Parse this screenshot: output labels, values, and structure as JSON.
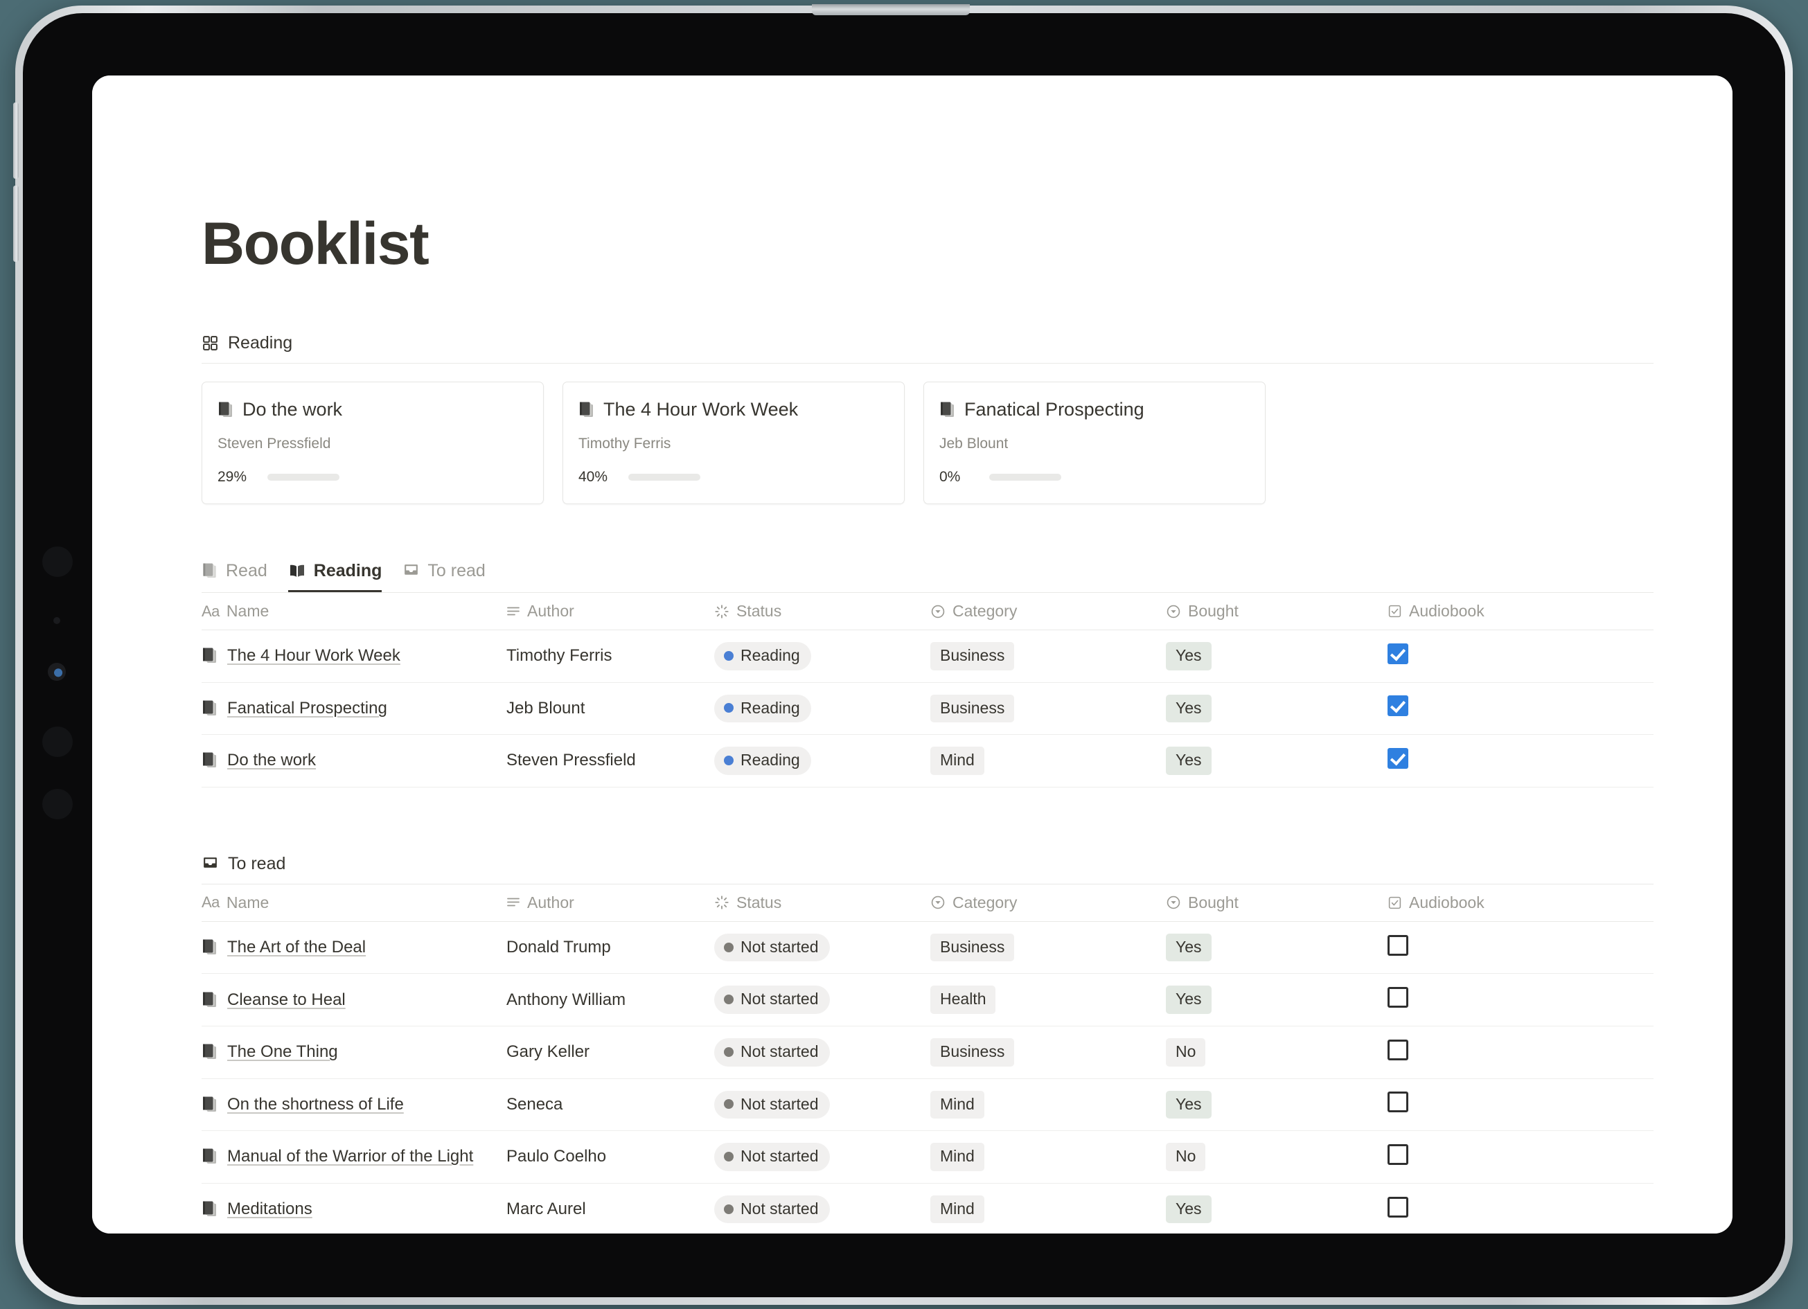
{
  "page": {
    "title": "Booklist"
  },
  "view": {
    "label": "Reading",
    "icon": "gallery-grid-icon"
  },
  "cards": [
    {
      "title": "Do the work",
      "author": "Steven Pressfield",
      "progress_label": "29%",
      "progress": 29,
      "icon": "closed-book-icon"
    },
    {
      "title": "The 4 Hour Work Week",
      "author": "Timothy Ferris",
      "progress_label": "40%",
      "progress": 40,
      "icon": "closed-book-icon"
    },
    {
      "title": "Fanatical Prospecting",
      "author": "Jeb Blount",
      "progress_label": "0%",
      "progress": 0,
      "icon": "closed-book-icon"
    }
  ],
  "tabs": [
    {
      "label": "Read",
      "icon": "closed-book-icon",
      "active": false
    },
    {
      "label": "Reading",
      "icon": "open-book-icon",
      "active": true
    },
    {
      "label": "To read",
      "icon": "inbox-tray-icon",
      "active": false
    }
  ],
  "columns": [
    {
      "label": "Name",
      "icon": "text-aa-icon"
    },
    {
      "label": "Author",
      "icon": "text-lines-icon"
    },
    {
      "label": "Status",
      "icon": "status-spinner-icon"
    },
    {
      "label": "Category",
      "icon": "select-circle-icon"
    },
    {
      "label": "Bought",
      "icon": "select-circle-icon"
    },
    {
      "label": "Audiobook",
      "icon": "checkbox-icon"
    }
  ],
  "reading_table": {
    "rows": [
      {
        "name": "The 4 Hour Work Week",
        "author": "Timothy Ferris",
        "status": "Reading",
        "status_color": "#4a7fd4",
        "category": "Business",
        "bought": "Yes",
        "audiobook": true
      },
      {
        "name": "Fanatical Prospecting",
        "author": "Jeb Blount",
        "status": "Reading",
        "status_color": "#4a7fd4",
        "category": "Business",
        "bought": "Yes",
        "audiobook": true
      },
      {
        "name": "Do the work",
        "author": "Steven Pressfield",
        "status": "Reading",
        "status_color": "#4a7fd4",
        "category": "Mind",
        "bought": "Yes",
        "audiobook": true
      }
    ]
  },
  "toread_section": {
    "label": "To read",
    "icon": "inbox-tray-icon",
    "rows": [
      {
        "name": "The Art of the Deal",
        "author": "Donald Trump",
        "status": "Not started",
        "status_color": "#7d7b76",
        "category": "Business",
        "bought": "Yes",
        "audiobook": false
      },
      {
        "name": "Cleanse to Heal",
        "author": "Anthony William",
        "status": "Not started",
        "status_color": "#7d7b76",
        "category": "Health",
        "bought": "Yes",
        "audiobook": false
      },
      {
        "name": "The One Thing",
        "author": "Gary Keller",
        "status": "Not started",
        "status_color": "#7d7b76",
        "category": "Business",
        "bought": "No",
        "audiobook": false
      },
      {
        "name": "On the shortness of Life",
        "author": "Seneca",
        "status": "Not started",
        "status_color": "#7d7b76",
        "category": "Mind",
        "bought": "Yes",
        "audiobook": false
      },
      {
        "name": "Manual of the Warrior of the Light",
        "author": "Paulo Coelho",
        "status": "Not started",
        "status_color": "#7d7b76",
        "category": "Mind",
        "bought": "No",
        "audiobook": false
      },
      {
        "name": "Meditations",
        "author": "Marc Aurel",
        "status": "Not started",
        "status_color": "#7d7b76",
        "category": "Mind",
        "bought": "Yes",
        "audiobook": false
      }
    ]
  },
  "colors": {
    "text": "#37352f",
    "muted": "#9b9a94",
    "accent_checkbox": "#2f80e0",
    "status_reading_dot": "#4a7fd4",
    "status_notstarted_dot": "#7d7b76",
    "tag_bg": "#f1f0ef",
    "tag_yes_bg": "#e3e9e3",
    "progress_fill": "#5d5c57",
    "progress_track": "#e9e9e7",
    "desk_background": "#4c6c74"
  }
}
